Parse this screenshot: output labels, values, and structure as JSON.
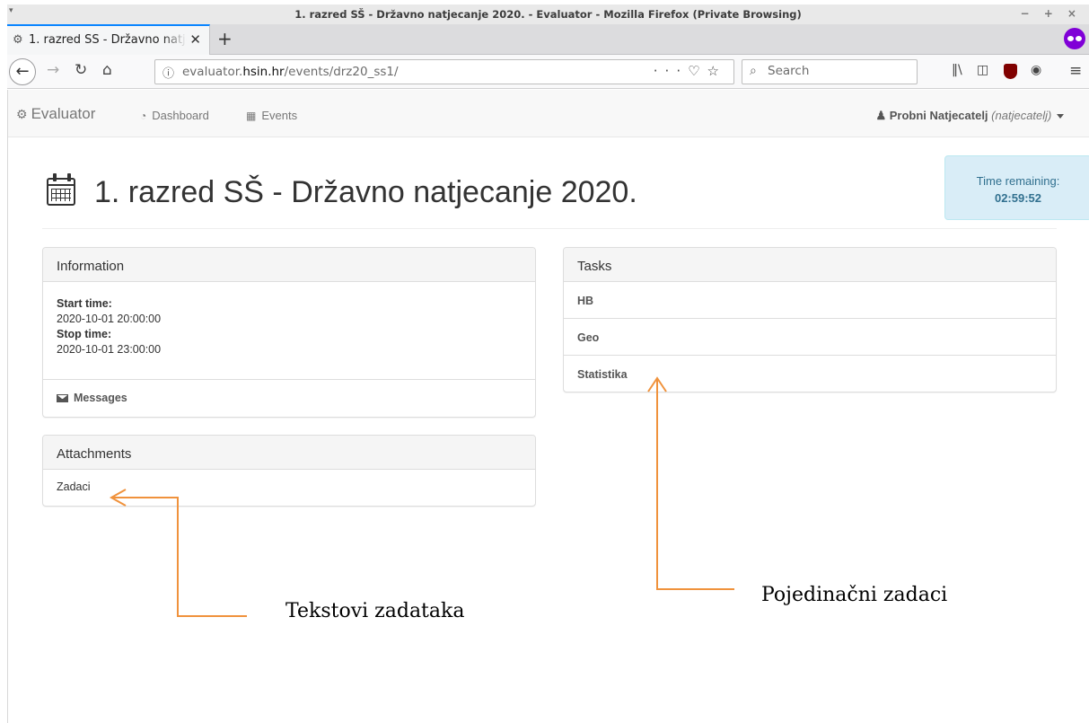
{
  "window": {
    "title": "1. razred SŠ - Državno natjecanje 2020. - Evaluator - Mozilla Firefox (Private Browsing)",
    "menu_icon": "▾",
    "controls": "− + ×"
  },
  "tabs": [
    {
      "label": "1. razred SŠ - Državno natjecanje 2020. - Evaluator",
      "icon": "cogs-icon",
      "active": true
    }
  ],
  "toolbar": {
    "url_host_prefix": "evaluator.",
    "url_host": "hsin.hr",
    "url_path": "/events/drz20_ss1/",
    "search_placeholder": "Search"
  },
  "app": {
    "brand": "Evaluator",
    "nav": [
      {
        "label": "Dashboard",
        "icon": "dashboard-icon"
      },
      {
        "label": "Events",
        "icon": "calendar-icon"
      }
    ],
    "user": {
      "name": "Probni Natjecatelj",
      "username": "(natjecatelj)"
    }
  },
  "event": {
    "title": "1. razred SŠ - Državno natjecanje 2020.",
    "time_remaining_label": "Time remaining:",
    "time_remaining_value": "02:59:52"
  },
  "information": {
    "heading": "Information",
    "start_label": "Start time:",
    "start_value": "2020-10-01 20:00:00",
    "stop_label": "Stop time:",
    "stop_value": "2020-10-01 23:00:00",
    "messages_label": "Messages"
  },
  "attachments": {
    "heading": "Attachments",
    "items": [
      "Zadaci"
    ]
  },
  "tasks": {
    "heading": "Tasks",
    "items": [
      "HB",
      "Geo",
      "Statistika"
    ]
  },
  "annotations": {
    "tasks_note": "Pojedinačni zadaci",
    "texts_note": "Tekstovi zadataka",
    "arrow_color": "#f0923c"
  },
  "colors": {
    "tab_accent": "#0a84ff",
    "timer_bg": "#d9edf7",
    "timer_text": "#31708f",
    "private_browsing": "#8000d7"
  }
}
